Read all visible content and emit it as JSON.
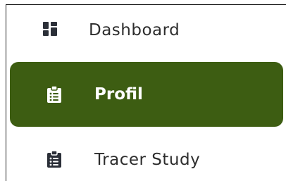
{
  "sidebar": {
    "items": [
      {
        "label": "Dashboard",
        "icon": "dashboard-icon",
        "active": false
      },
      {
        "label": "Profil",
        "icon": "clipboard-list-icon",
        "active": true
      },
      {
        "label": "Tracer Study",
        "icon": "clipboard-list-icon",
        "active": false
      }
    ]
  },
  "colors": {
    "active_background": "#3d5d12",
    "active_text": "#ffffff",
    "text": "#2d2d2d",
    "icon": "#2b2f38"
  }
}
